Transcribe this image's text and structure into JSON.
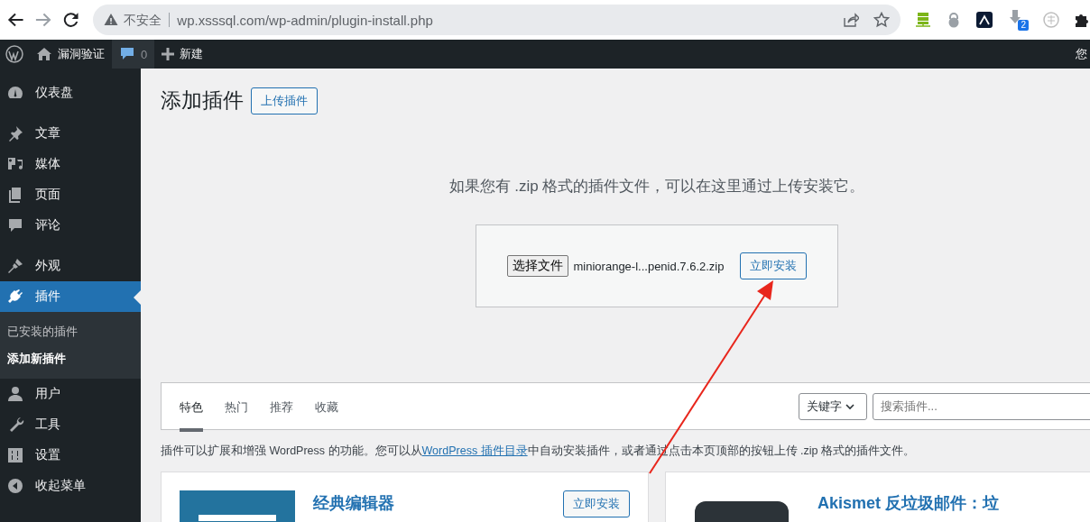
{
  "browser": {
    "back_enabled": true,
    "forward_enabled": false,
    "security_label": "不安全",
    "url": "wp.xsssql.com/wp-admin/plugin-install.php",
    "extension_badge": "2"
  },
  "admin_bar": {
    "site_name": "漏洞验证",
    "comments_count": "0",
    "new_label": "新建",
    "greeting": "您"
  },
  "sidebar": {
    "groups": [
      [
        {
          "label": "仪表盘",
          "selected": false
        }
      ],
      [
        {
          "label": "文章",
          "selected": false
        },
        {
          "label": "媒体",
          "selected": false
        },
        {
          "label": "页面",
          "selected": false
        },
        {
          "label": "评论",
          "selected": false
        }
      ],
      [
        {
          "label": "外观",
          "selected": false
        },
        {
          "label": "插件",
          "selected": true,
          "children": [
            {
              "label": "已安装的插件",
              "selected": false
            },
            {
              "label": "添加新插件",
              "selected": true
            }
          ]
        },
        {
          "label": "用户",
          "selected": false
        },
        {
          "label": "工具",
          "selected": false
        },
        {
          "label": "设置",
          "selected": false
        },
        {
          "label": "收起菜单",
          "selected": false
        }
      ]
    ]
  },
  "page": {
    "title": "添加插件",
    "upload_button": "上传插件"
  },
  "upload": {
    "description": "如果您有 .zip 格式的插件文件，可以在这里通过上传安装它。",
    "choose_file": "选择文件",
    "file_name": "miniorange-l...penid.7.6.2.zip",
    "install_button": "立即安装"
  },
  "filter": {
    "tabs": [
      {
        "label": "特色",
        "selected": true
      },
      {
        "label": "热门",
        "selected": false
      },
      {
        "label": "推荐",
        "selected": false
      },
      {
        "label": "收藏",
        "selected": false
      }
    ],
    "search_type": "关键字",
    "search_placeholder": "搜索插件..."
  },
  "note": {
    "before": "插件可以扩展和增强 WordPress 的功能。您可以从",
    "link": "WordPress 插件目录",
    "after": "中自动安装插件，或者通过点击本页顶部的按钮上传 .zip 格式的插件文件。"
  },
  "cards": [
    {
      "kind": "editor",
      "title": "经典编辑器",
      "install_button": "立即安装"
    },
    {
      "kind": "akismet",
      "title": "Akismet 反垃圾邮件：垃"
    }
  ]
}
